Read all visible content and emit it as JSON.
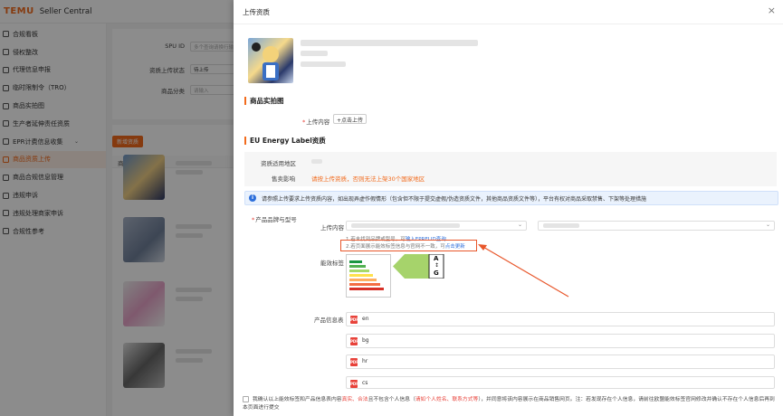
{
  "brand": {
    "logo": "TEMU",
    "subtitle": "Seller Central",
    "accent": "#f26b1d"
  },
  "sidebar": {
    "items": [
      {
        "label": "合规看板",
        "icon": "dashboard-icon"
      },
      {
        "label": "侵权整改",
        "icon": "warning-icon"
      },
      {
        "label": "代理信息申报",
        "icon": "agent-icon"
      },
      {
        "label": "临时限制令（TRO）",
        "icon": "shield-icon"
      },
      {
        "label": "商品实拍图",
        "icon": "camera-icon"
      },
      {
        "label": "生产者延伸责任资质",
        "icon": "certificate-icon"
      },
      {
        "label": "EPR计费信息收集",
        "icon": "billing-icon",
        "expandable": true
      },
      {
        "label": "商品资质上传",
        "icon": "upload-icon",
        "active": true
      },
      {
        "label": "商品合规信息管理",
        "icon": "folder-icon"
      },
      {
        "label": "违规申诉",
        "icon": "appeal-icon"
      },
      {
        "label": "违规处理商家申诉",
        "icon": "complaint-icon"
      },
      {
        "label": "合规性参考",
        "icon": "reference-icon"
      }
    ]
  },
  "filters": {
    "spu_label": "SPU ID",
    "spu_placeholder": "多个查询请换行输入",
    "status_label": "资质上传状态",
    "status_value": "待上传",
    "category_label": "商品分类",
    "category_placeholder": "请输入"
  },
  "list": {
    "add_button": "新增资质",
    "column_header": "商品信息"
  },
  "drawer": {
    "title": "上传资质",
    "close": "×",
    "section_photo": "商品实拍图",
    "upload_content_label": "上传内容",
    "upload_button": "+点击上传",
    "section_energy": "EU Energy Label资质",
    "region_label": "资质适用地区",
    "impact_label": "售卖影响",
    "impact_text": "请按上传资质，否则无法上架30个国家地区",
    "notice": "请参照上传要求上传资质内容，如出现弄虚作假情形（包含但不限于提交虚假/伪造资质文件，其他商品资质文件等），平台有权对商品采取禁售、下架等处理措施",
    "brand_model_label": "产品品牌与型号",
    "upload_content_label2": "上传内容",
    "hint1_prefix": "1.若未找到品牌或型号，可",
    "hint1_link": "输入EPRELID查询",
    "hint2_prefix": "2.若页面展示能效标签信息与官网不一致，可",
    "hint2_link": "点击更新",
    "energy_label_label": "能效标签",
    "energy_grade_top": "A",
    "energy_grade_bottom": "G",
    "product_info_label": "产品信息表",
    "product_sheets": [
      "en",
      "bg",
      "hr",
      "cs"
    ],
    "doc_icon_text": "PDF"
  },
  "footer": {
    "part1": "我确认以上能效标签和产品信息表内容",
    "part2": "真实、合法",
    "part3": "且不包含个人信息（",
    "part4": "请如个人姓名、联系方式等",
    "part5": "），并同意将该内容展示在商品销售网页。注：若发现存在个人信息，请前往欧盟能效标签官网修改并确认不存在个人信息后再到本页面进行提交"
  }
}
